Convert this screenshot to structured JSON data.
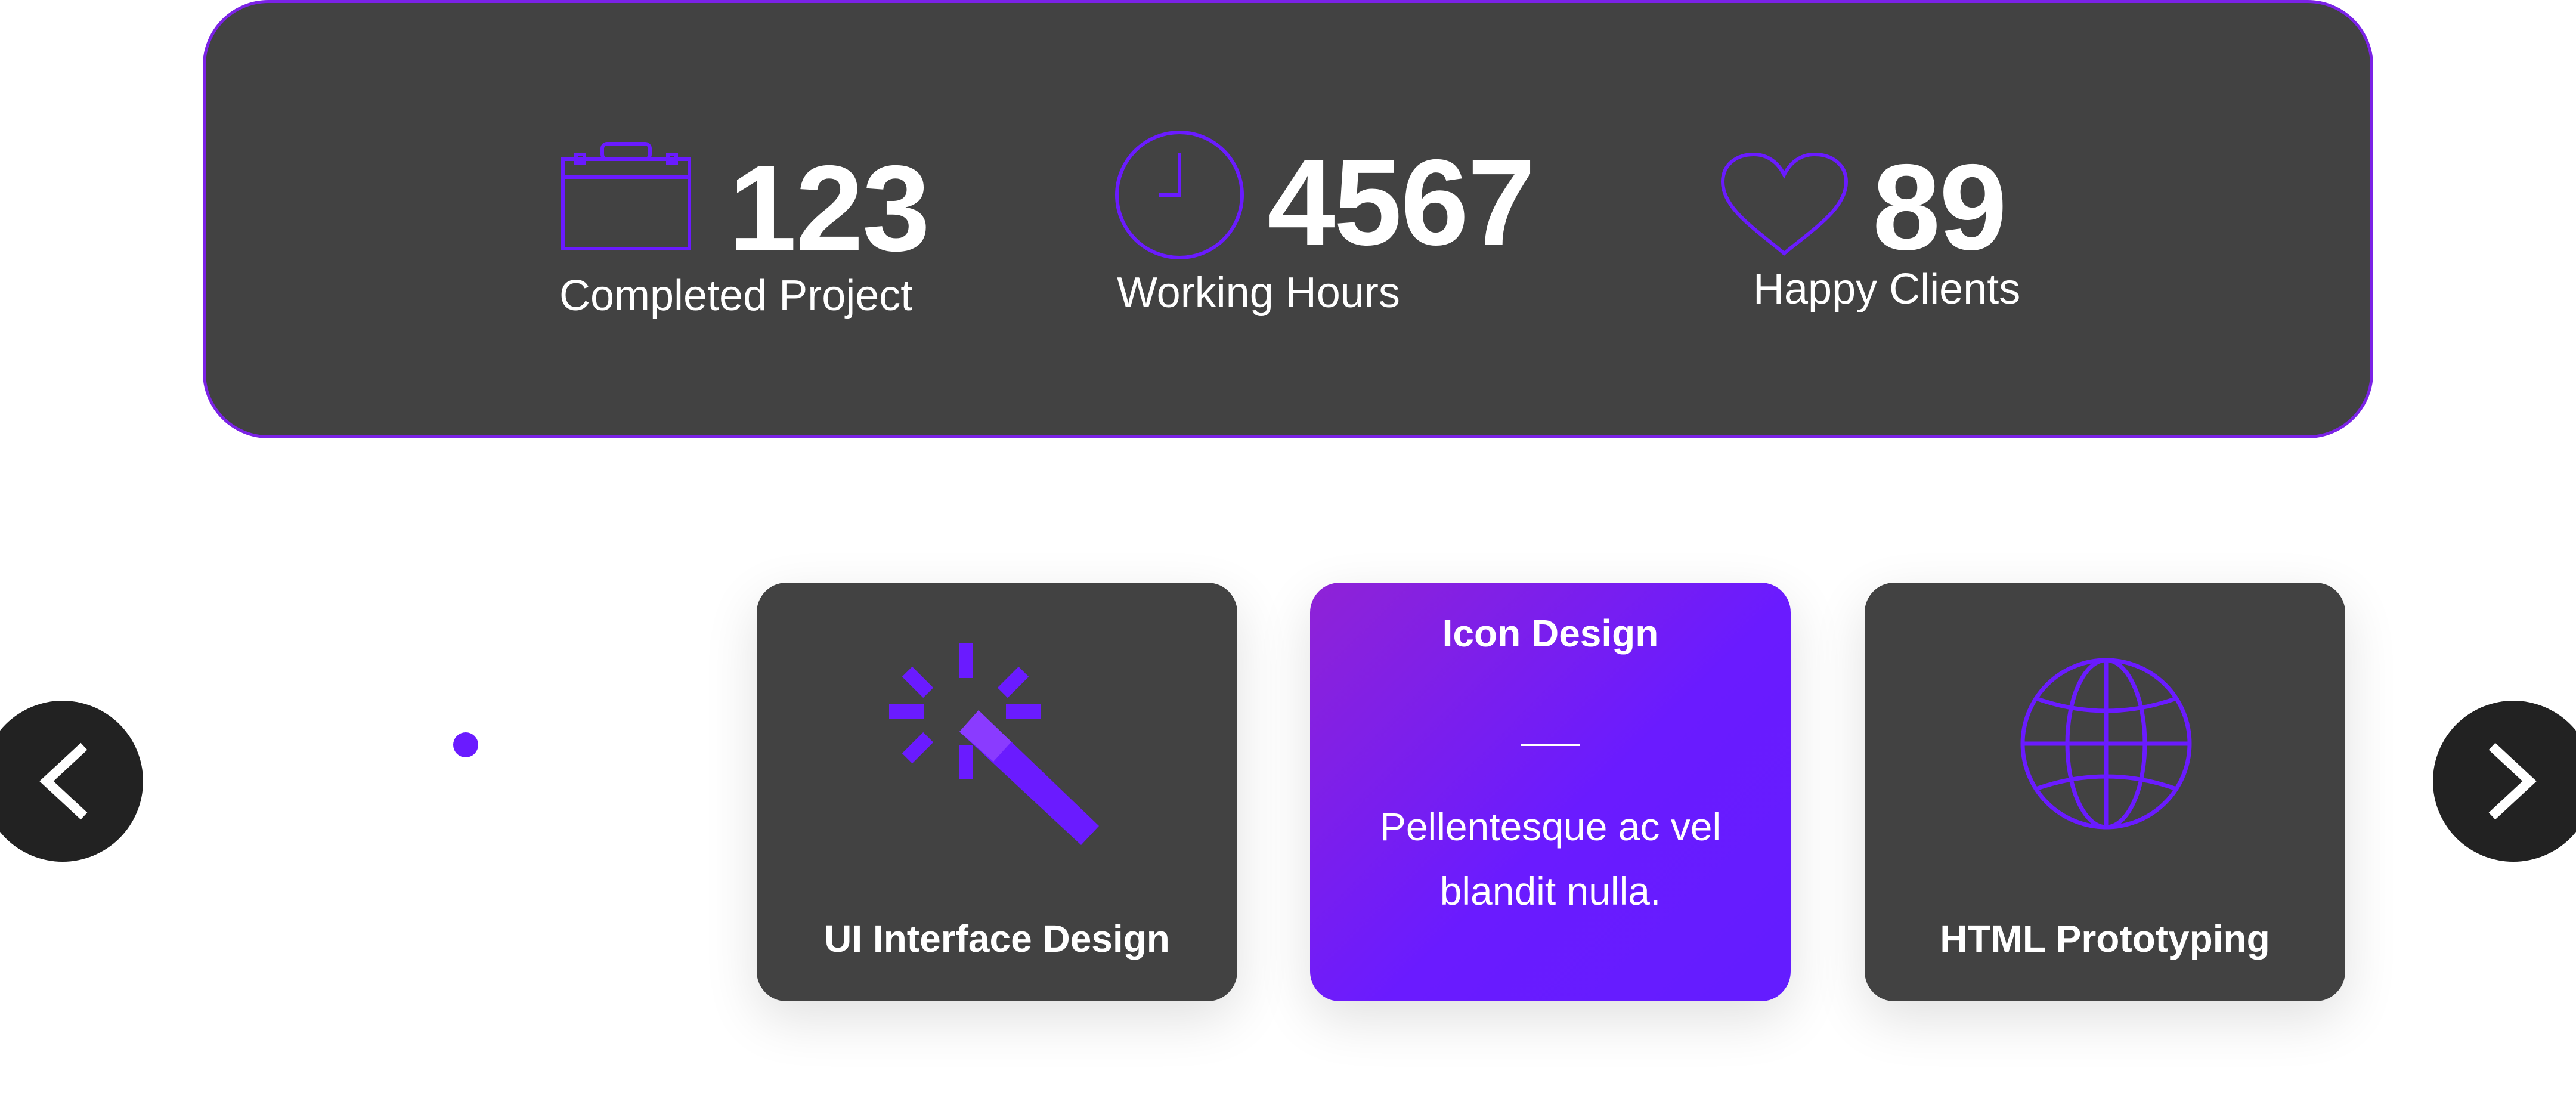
{
  "colors": {
    "accent": "#6a1bff",
    "accent_gradient_start": "#8f23d6",
    "panel_bg": "#424242",
    "nav_bg": "#222222",
    "text": "#ffffff"
  },
  "stats": [
    {
      "icon": "briefcase-icon",
      "number": "123",
      "label": "Completed Project"
    },
    {
      "icon": "clock-icon",
      "number": "4567",
      "label": "Working Hours"
    },
    {
      "icon": "heart-icon",
      "number": "89",
      "label": "Happy Clients"
    }
  ],
  "cards": [
    {
      "icon": "magic-wand-icon",
      "title": "UI Interface Design",
      "active": false
    },
    {
      "title": "Icon Design",
      "description": "Pellentesque ac  vel blandit nulla.",
      "active": true
    },
    {
      "icon": "globe-icon",
      "title": "HTML Prototyping",
      "active": false
    }
  ],
  "carousel": {
    "prev_icon": "chevron-left-icon",
    "next_icon": "chevron-right-icon"
  }
}
